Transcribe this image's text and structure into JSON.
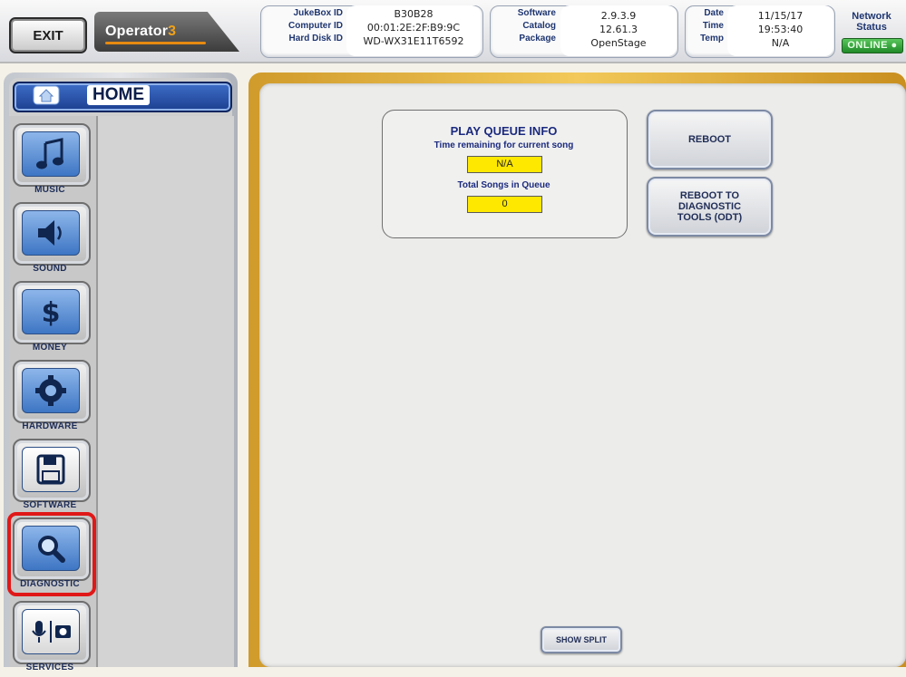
{
  "header": {
    "exit_label": "EXIT",
    "brand_name": "Operator",
    "brand_version": "3",
    "jukebox": {
      "labels": [
        "JukeBox ID",
        "Computer ID",
        "Hard Disk ID"
      ],
      "values": [
        "B30B28",
        "00:01:2E:2F:B9:9C",
        "WD-WX31E11T6592"
      ]
    },
    "software": {
      "labels": [
        "Software",
        "Catalog",
        "Package"
      ],
      "values": [
        "2.9.3.9",
        "12.61.3",
        "OpenStage"
      ]
    },
    "datetime": {
      "labels": [
        "Date",
        "Time",
        "Temp"
      ],
      "values": [
        "11/15/17",
        "19:53:40",
        "N/A"
      ]
    },
    "network": {
      "label_line1": "Network",
      "label_line2": "Status",
      "status": "ONLINE"
    }
  },
  "sidebar": {
    "home_label": "HOME",
    "items": [
      {
        "label": "MUSIC",
        "icon": "music-note-icon"
      },
      {
        "label": "SOUND",
        "icon": "speaker-icon"
      },
      {
        "label": "MONEY",
        "icon": "dollar-icon"
      },
      {
        "label": "HARDWARE",
        "icon": "gear-icon"
      },
      {
        "label": "SOFTWARE",
        "icon": "floppy-disk-icon"
      },
      {
        "label": "DIAGNOSTIC",
        "icon": "magnifier-icon",
        "selected": true
      },
      {
        "label": "SERVICES",
        "icon": "mic-camera-icon"
      }
    ]
  },
  "main": {
    "play_queue": {
      "title": "PLAY QUEUE INFO",
      "time_remaining_label": "Time remaining for current song",
      "time_remaining_value": "N/A",
      "total_songs_label": "Total Songs in Queue",
      "total_songs_value": "0"
    },
    "reboot_label": "REBOOT",
    "reboot_odt_label": "REBOOT TO\nDIAGNOSTIC\nTOOLS (ODT)",
    "show_split_label": "SHOW SPLIT"
  },
  "colors": {
    "highlight_red": "#e01818",
    "queue_value_yellow": "#ffe800",
    "online_green": "#2fa33a",
    "frame_gold": "#e2b445",
    "brand_orange": "#f0a21a"
  }
}
